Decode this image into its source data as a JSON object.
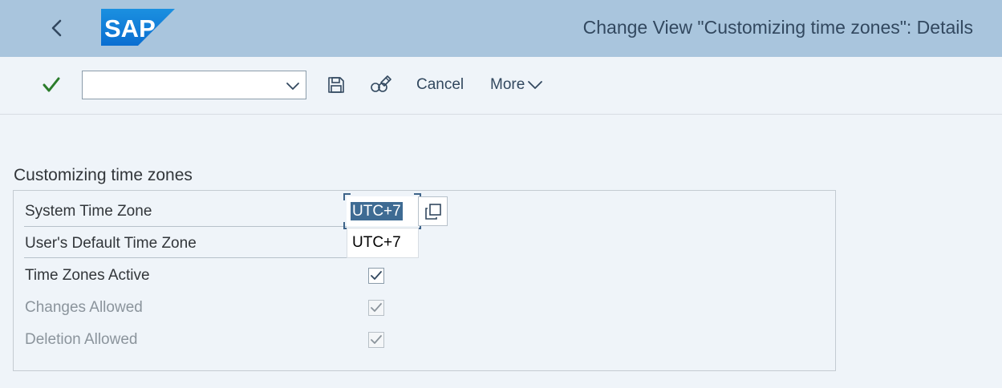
{
  "header": {
    "title": "Change View \"Customizing time zones\": Details",
    "logo_text": "SAP",
    "back_icon": "chevron-left-icon",
    "brand_color": "#0a6ed1"
  },
  "toolbar": {
    "ok_icon": "checkmark-icon",
    "command_field": {
      "value": "",
      "placeholder": ""
    },
    "save_icon": "save-icon",
    "other_object_icon": "glasses-pencil-icon",
    "cancel_label": "Cancel",
    "more_label": "More"
  },
  "form": {
    "section_title": "Customizing time zones",
    "fields": [
      {
        "label": "System Time Zone",
        "value": "UTC+7",
        "editable": true,
        "selected": true
      },
      {
        "label": "User's Default Time Zone",
        "value": "UTC+7",
        "editable": false
      }
    ],
    "checkboxes": [
      {
        "label": "Time Zones Active",
        "checked": true,
        "enabled": true
      },
      {
        "label": "Changes Allowed",
        "checked": true,
        "enabled": false
      },
      {
        "label": "Deletion Allowed",
        "checked": true,
        "enabled": false
      }
    ]
  },
  "colors": {
    "shell": "#a9c5dd",
    "background": "#eff4f9",
    "selection": "#3e6b93",
    "ok_green": "#2b7c2b",
    "link_text": "#32485f"
  }
}
